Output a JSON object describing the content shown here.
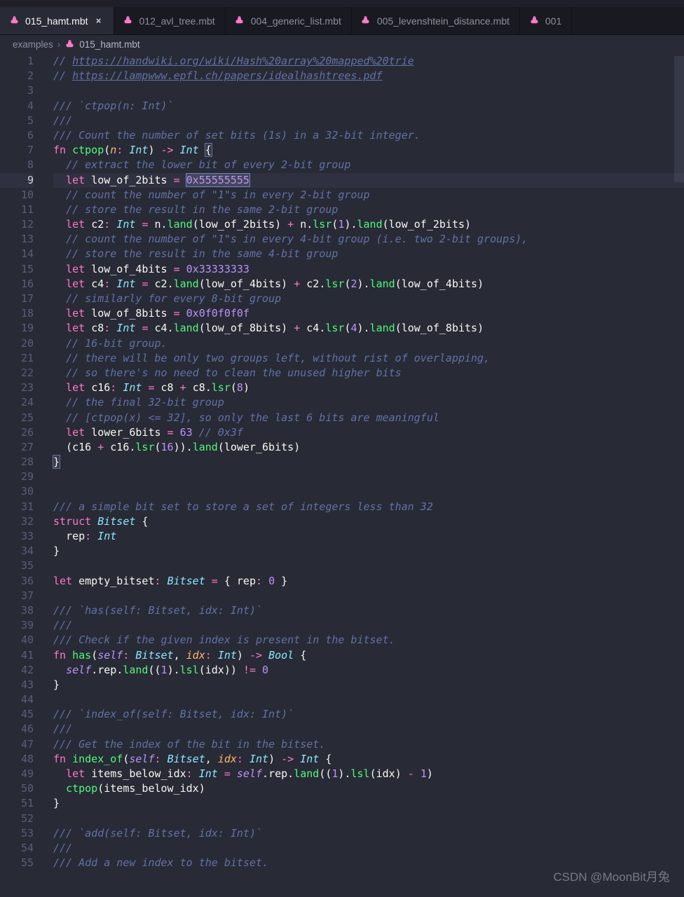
{
  "tabs": [
    {
      "label": "015_hamt.mbt",
      "active": true
    },
    {
      "label": "012_avl_tree.mbt",
      "active": false
    },
    {
      "label": "004_generic_list.mbt",
      "active": false
    },
    {
      "label": "005_levenshtein_distance.mbt",
      "active": false
    },
    {
      "label": "001",
      "active": false
    }
  ],
  "breadcrumb": {
    "folder": "examples",
    "file": "015_hamt.mbt"
  },
  "current_line": 9,
  "line_count": 55,
  "watermark": "CSDN @MoonBit月兔",
  "links": {
    "handwiki": "https://handwiki.org/wiki/Hash%20array%20mapped%20trie",
    "epfl": "https://lampwww.epfl.ch/papers/idealhashtrees.pdf"
  },
  "selection": "0x55555555",
  "code": [
    {
      "t": "comment_link",
      "prefix": "// ",
      "href": "links.handwiki"
    },
    {
      "t": "comment_link",
      "prefix": "// ",
      "href": "links.epfl"
    },
    {
      "t": "blank"
    },
    {
      "t": "doc",
      "text": "/// `ctpop(n: Int)`"
    },
    {
      "t": "doc",
      "text": "///"
    },
    {
      "t": "doc",
      "text": "/// Count the number of set bits (1s) in a 32-bit integer."
    },
    {
      "t": "fn_sig",
      "name": "ctpop",
      "params": [
        {
          "name": "n",
          "type": "Int"
        }
      ],
      "ret": "Int"
    },
    {
      "t": "comment_i2",
      "text": "// extract the lower bit of every 2-bit group"
    },
    {
      "t": "let_hex",
      "indent": 2,
      "name": "low_of_2bits",
      "value": "0x55555555",
      "highlight": true
    },
    {
      "t": "comment_i2",
      "text": "// count the number of \"1\"s in every 2-bit group"
    },
    {
      "t": "comment_i2",
      "text": "// store the result in the same 2-bit group"
    },
    {
      "t": "raw_i2",
      "html": "<span class='tok-keyword'>let</span> <span class='tok-ident'>c2</span><span class='tok-op'>:</span> <span class='tok-type'>Int</span> <span class='tok-op'>=</span> <span class='tok-ident'>n</span><span class='tok-punct'>.</span><span class='tok-func'>land</span><span class='tok-punct'>(</span><span class='tok-ident'>low_of_2bits</span><span class='tok-punct'>)</span> <span class='tok-op'>+</span> <span class='tok-ident'>n</span><span class='tok-punct'>.</span><span class='tok-func'>lsr</span><span class='tok-punct'>(</span><span class='tok-num'>1</span><span class='tok-punct'>).</span><span class='tok-func'>land</span><span class='tok-punct'>(</span><span class='tok-ident'>low_of_2bits</span><span class='tok-punct'>)</span>"
    },
    {
      "t": "comment_i2",
      "text": "// count the number of \"1\"s in every 4-bit group (i.e. two 2-bit groups),"
    },
    {
      "t": "comment_i2",
      "text": "// store the result in the same 4-bit group"
    },
    {
      "t": "raw_i2",
      "html": "<span class='tok-keyword'>let</span> <span class='tok-ident'>low_of_4bits</span> <span class='tok-op'>=</span> <span class='tok-num'>0x33333333</span>"
    },
    {
      "t": "raw_i2",
      "html": "<span class='tok-keyword'>let</span> <span class='tok-ident'>c4</span><span class='tok-op'>:</span> <span class='tok-type'>Int</span> <span class='tok-op'>=</span> <span class='tok-ident'>c2</span><span class='tok-punct'>.</span><span class='tok-func'>land</span><span class='tok-punct'>(</span><span class='tok-ident'>low_of_4bits</span><span class='tok-punct'>)</span> <span class='tok-op'>+</span> <span class='tok-ident'>c2</span><span class='tok-punct'>.</span><span class='tok-func'>lsr</span><span class='tok-punct'>(</span><span class='tok-num'>2</span><span class='tok-punct'>).</span><span class='tok-func'>land</span><span class='tok-punct'>(</span><span class='tok-ident'>low_of_4bits</span><span class='tok-punct'>)</span>"
    },
    {
      "t": "comment_i2",
      "text": "// similarly for every 8-bit group"
    },
    {
      "t": "raw_i2",
      "html": "<span class='tok-keyword'>let</span> <span class='tok-ident'>low_of_8bits</span> <span class='tok-op'>=</span> <span class='tok-num'>0x0f0f0f0f</span>"
    },
    {
      "t": "raw_i2",
      "html": "<span class='tok-keyword'>let</span> <span class='tok-ident'>c8</span><span class='tok-op'>:</span> <span class='tok-type'>Int</span> <span class='tok-op'>=</span> <span class='tok-ident'>c4</span><span class='tok-punct'>.</span><span class='tok-func'>land</span><span class='tok-punct'>(</span><span class='tok-ident'>low_of_8bits</span><span class='tok-punct'>)</span> <span class='tok-op'>+</span> <span class='tok-ident'>c4</span><span class='tok-punct'>.</span><span class='tok-func'>lsr</span><span class='tok-punct'>(</span><span class='tok-num'>4</span><span class='tok-punct'>).</span><span class='tok-func'>land</span><span class='tok-punct'>(</span><span class='tok-ident'>low_of_8bits</span><span class='tok-punct'>)</span>"
    },
    {
      "t": "comment_i2",
      "text": "// 16-bit group."
    },
    {
      "t": "comment_i2",
      "text": "// there will be only two groups left, without rist of overlapping,"
    },
    {
      "t": "comment_i2",
      "text": "// so there's no need to clean the unused higher bits"
    },
    {
      "t": "raw_i2",
      "html": "<span class='tok-keyword'>let</span> <span class='tok-ident'>c16</span><span class='tok-op'>:</span> <span class='tok-type'>Int</span> <span class='tok-op'>=</span> <span class='tok-ident'>c8</span> <span class='tok-op'>+</span> <span class='tok-ident'>c8</span><span class='tok-punct'>.</span><span class='tok-func'>lsr</span><span class='tok-punct'>(</span><span class='tok-num'>8</span><span class='tok-punct'>)</span>"
    },
    {
      "t": "comment_i2",
      "text": "// the final 32-bit group"
    },
    {
      "t": "comment_i2",
      "text": "// [ctpop(x) <= 32], so only the last 6 bits are meaningful"
    },
    {
      "t": "raw_i2",
      "html": "<span class='tok-keyword'>let</span> <span class='tok-ident'>lower_6bits</span> <span class='tok-op'>=</span> <span class='tok-num'>63</span> <span class='tok-comment'>// 0x3f</span>"
    },
    {
      "t": "raw_i2",
      "html": "<span class='tok-punct'>(</span><span class='tok-ident'>c16</span> <span class='tok-op'>+</span> <span class='tok-ident'>c16</span><span class='tok-punct'>.</span><span class='tok-func'>lsr</span><span class='tok-punct'>(</span><span class='tok-num'>16</span><span class='tok-punct'>)).</span><span class='tok-func'>land</span><span class='tok-punct'>(</span><span class='tok-ident'>lower_6bits</span><span class='tok-punct'>)</span>"
    },
    {
      "t": "close_brace",
      "match": true
    },
    {
      "t": "blank"
    },
    {
      "t": "blank"
    },
    {
      "t": "doc",
      "text": "/// a simple bit set to store a set of integers less than 32"
    },
    {
      "t": "raw",
      "html": "<span class='tok-keyword'>struct</span> <span class='tok-type'>Bitset</span> <span class='tok-punct'>{</span>"
    },
    {
      "t": "raw_i2",
      "html": "<span class='tok-ident'>rep</span><span class='tok-op'>:</span> <span class='tok-type'>Int</span>"
    },
    {
      "t": "raw",
      "html": "<span class='tok-punct'>}</span>"
    },
    {
      "t": "blank"
    },
    {
      "t": "raw",
      "html": "<span class='tok-keyword'>let</span> <span class='tok-ident'>empty_bitset</span><span class='tok-op'>:</span> <span class='tok-type'>Bitset</span> <span class='tok-op'>=</span> <span class='tok-punct'>{</span> <span class='tok-ident'>rep</span><span class='tok-op'>:</span> <span class='tok-num'>0</span> <span class='tok-punct'>}</span>"
    },
    {
      "t": "blank"
    },
    {
      "t": "doc",
      "text": "/// `has(self: Bitset, idx: Int)`"
    },
    {
      "t": "doc",
      "text": "///"
    },
    {
      "t": "doc",
      "text": "/// Check if the given index is present in the bitset."
    },
    {
      "t": "raw",
      "html": "<span class='tok-keyword'>fn</span> <span class='tok-func'>has</span><span class='tok-punct'>(</span><span class='tok-self'>self</span><span class='tok-op'>:</span> <span class='tok-type'>Bitset</span><span class='tok-punct'>,</span> <span class='tok-param'>idx</span><span class='tok-op'>:</span> <span class='tok-type'>Int</span><span class='tok-punct'>)</span> <span class='tok-op'>-&gt;</span> <span class='tok-type'>Bool</span> <span class='tok-punct'>{</span>"
    },
    {
      "t": "raw_i2",
      "html": "<span class='tok-self'>self</span><span class='tok-punct'>.</span><span class='tok-ident'>rep</span><span class='tok-punct'>.</span><span class='tok-func'>land</span><span class='tok-punct'>((</span><span class='tok-num'>1</span><span class='tok-punct'>).</span><span class='tok-func'>lsl</span><span class='tok-punct'>(</span><span class='tok-ident'>idx</span><span class='tok-punct'>))</span> <span class='tok-op'>!=</span> <span class='tok-num'>0</span>"
    },
    {
      "t": "raw",
      "html": "<span class='tok-punct'>}</span>"
    },
    {
      "t": "blank"
    },
    {
      "t": "doc",
      "text": "/// `index_of(self: Bitset, idx: Int)`"
    },
    {
      "t": "doc",
      "text": "///"
    },
    {
      "t": "doc",
      "text": "/// Get the index of the bit in the bitset."
    },
    {
      "t": "raw",
      "html": "<span class='tok-keyword'>fn</span> <span class='tok-func'>index_of</span><span class='tok-punct'>(</span><span class='tok-self'>self</span><span class='tok-op'>:</span> <span class='tok-type'>Bitset</span><span class='tok-punct'>,</span> <span class='tok-param'>idx</span><span class='tok-op'>:</span> <span class='tok-type'>Int</span><span class='tok-punct'>)</span> <span class='tok-op'>-&gt;</span> <span class='tok-type'>Int</span> <span class='tok-punct'>{</span>"
    },
    {
      "t": "raw_i2",
      "html": "<span class='tok-keyword'>let</span> <span class='tok-ident'>items_below_idx</span><span class='tok-op'>:</span> <span class='tok-type'>Int</span> <span class='tok-op'>=</span> <span class='tok-self'>self</span><span class='tok-punct'>.</span><span class='tok-ident'>rep</span><span class='tok-punct'>.</span><span class='tok-func'>land</span><span class='tok-punct'>((</span><span class='tok-num'>1</span><span class='tok-punct'>).</span><span class='tok-func'>lsl</span><span class='tok-punct'>(</span><span class='tok-ident'>idx</span><span class='tok-punct'>)</span> <span class='tok-op'>-</span> <span class='tok-num'>1</span><span class='tok-punct'>)</span>"
    },
    {
      "t": "raw_i2",
      "html": "<span class='tok-func'>ctpop</span><span class='tok-punct'>(</span><span class='tok-ident'>items_below_idx</span><span class='tok-punct'>)</span>"
    },
    {
      "t": "raw",
      "html": "<span class='tok-punct'>}</span>"
    },
    {
      "t": "blank"
    },
    {
      "t": "doc",
      "text": "/// `add(self: Bitset, idx: Int)`"
    },
    {
      "t": "doc",
      "text": "///"
    },
    {
      "t": "doc",
      "text": "/// Add a new index to the bitset."
    }
  ]
}
